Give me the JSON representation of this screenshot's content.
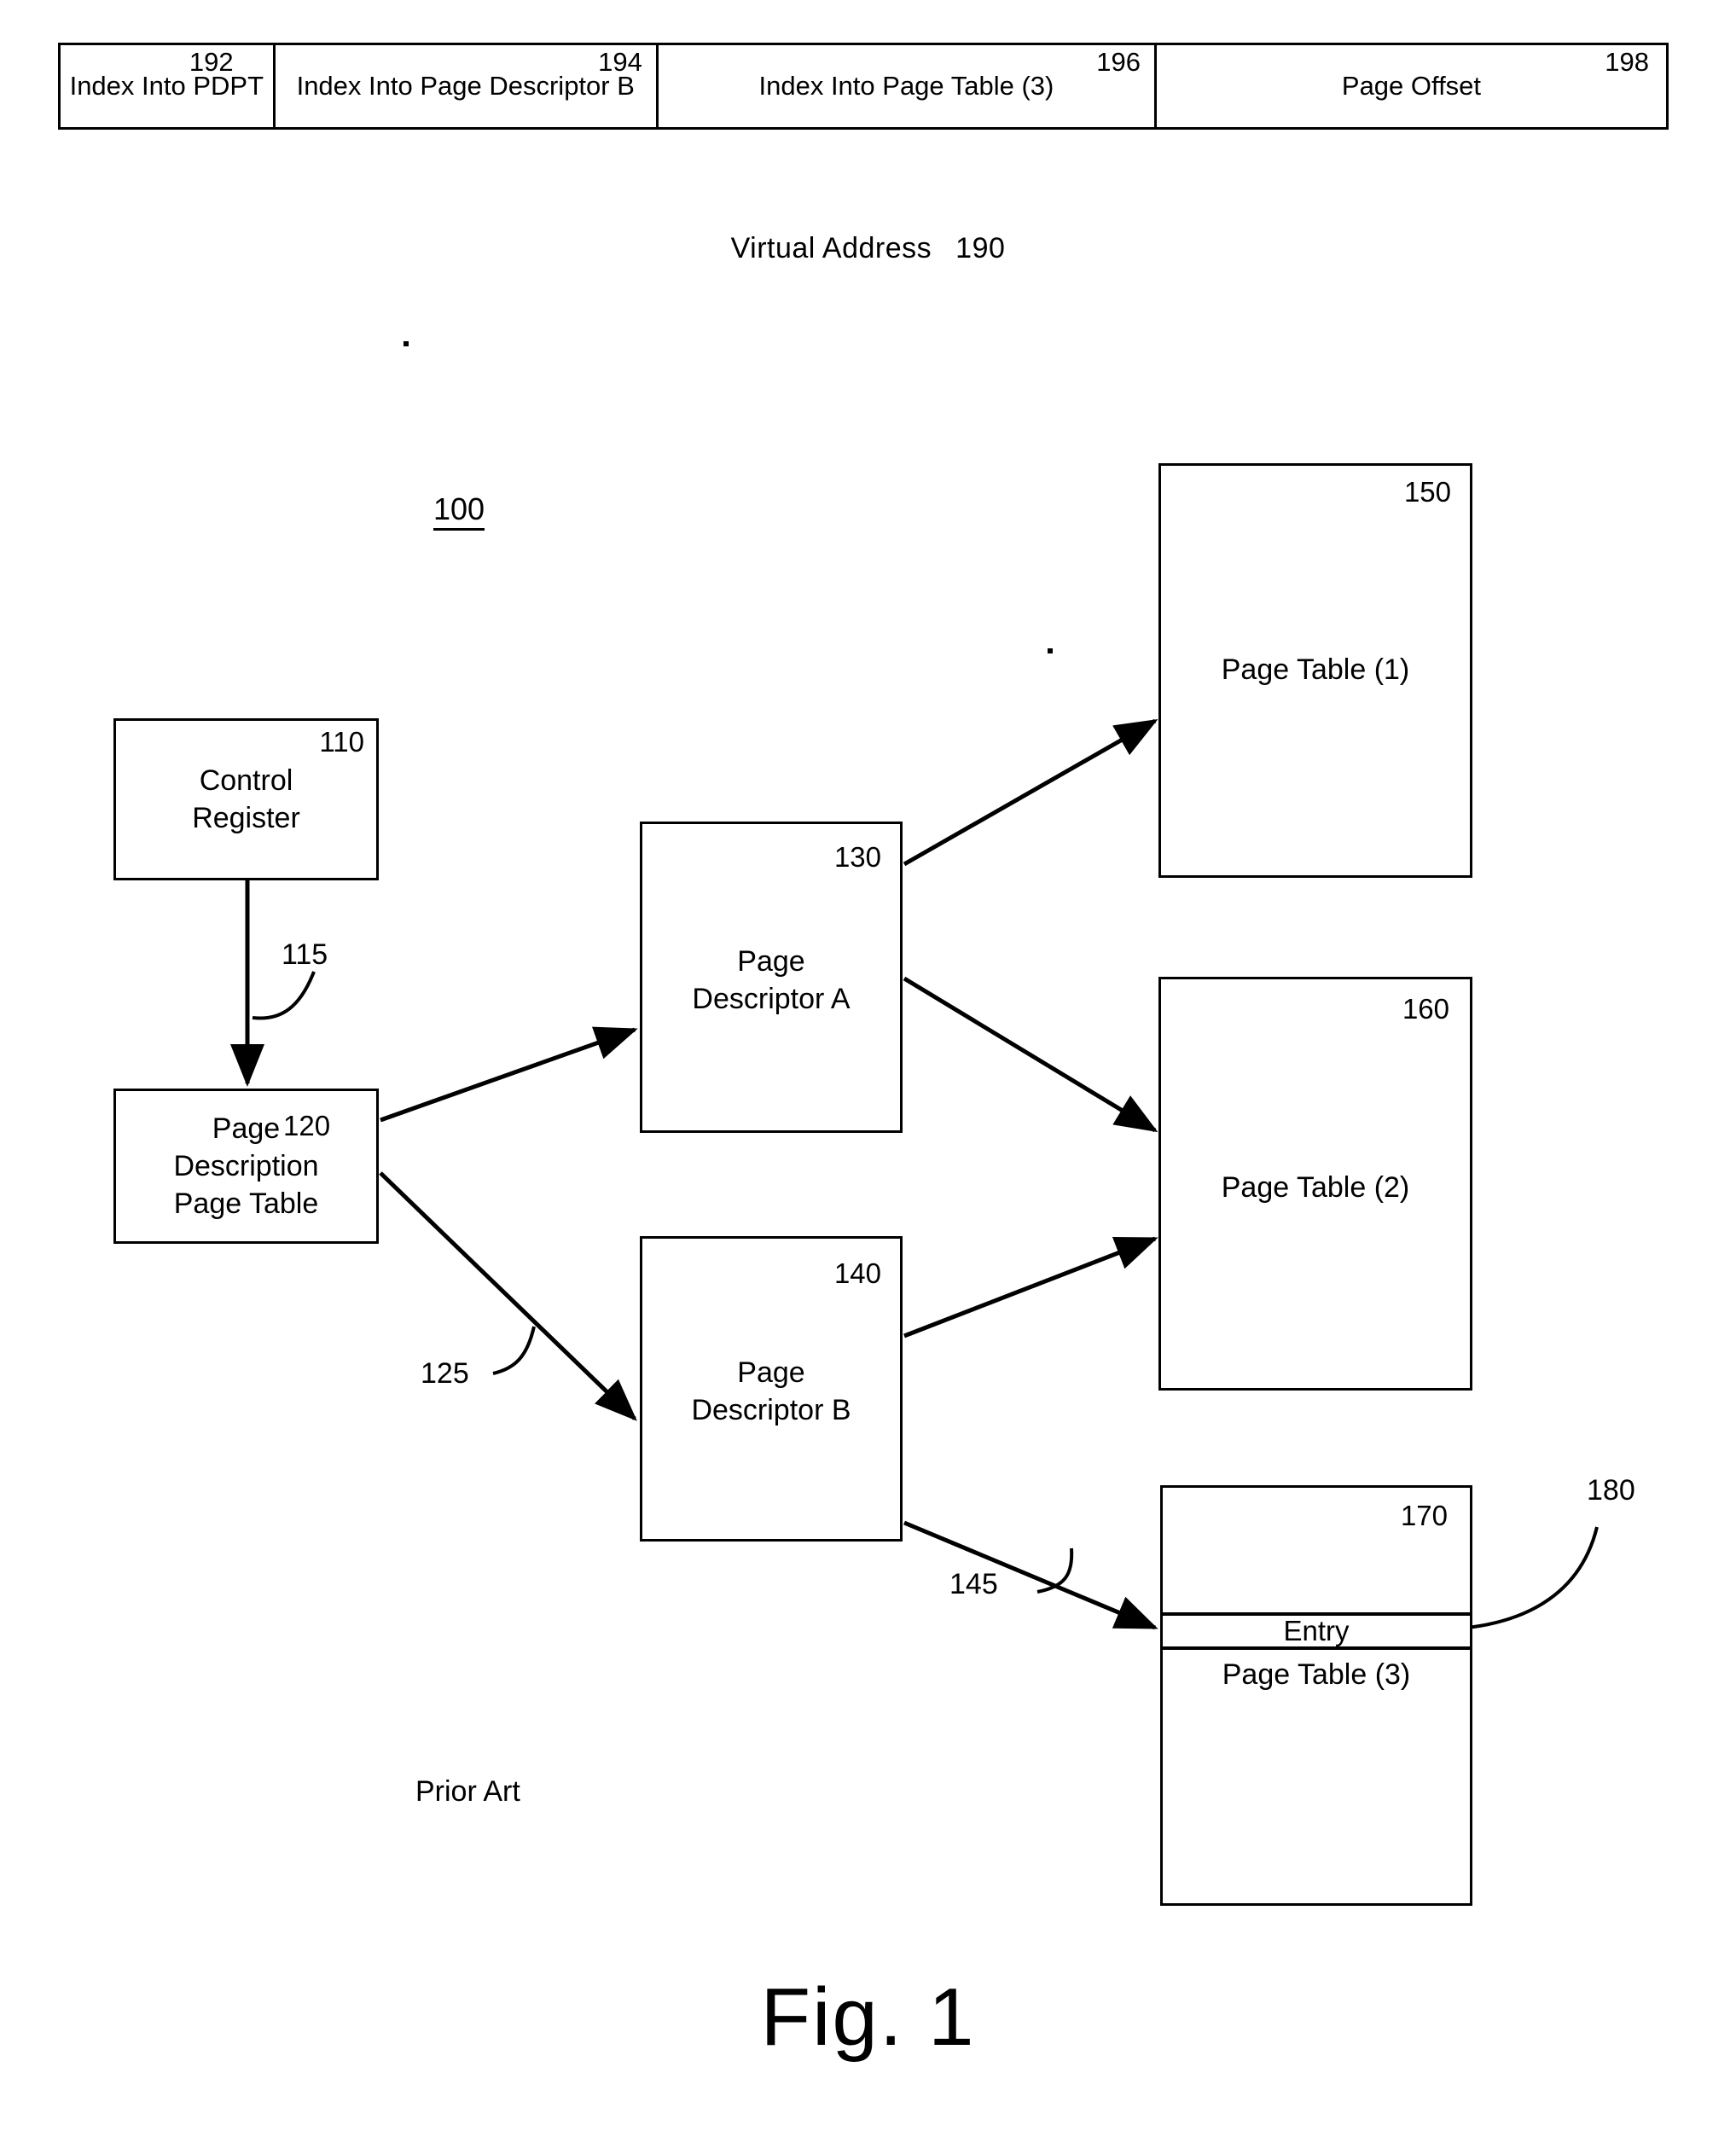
{
  "virtual_address": {
    "fields": [
      {
        "ref": "192",
        "label": "Index Into\nPDPT"
      },
      {
        "ref": "194",
        "label": "Index Into\nPage Descriptor B"
      },
      {
        "ref": "196",
        "label": "Index Into\nPage Table (3)"
      },
      {
        "ref": "198",
        "label": "Page Offset"
      }
    ],
    "caption": "Virtual Address",
    "caption_ref": "190"
  },
  "diagram": {
    "system_ref": "100",
    "boxes": {
      "control_register": {
        "ref": "110",
        "label": "Control\nRegister"
      },
      "page_description_page_table": {
        "ref": "120",
        "label": "Page\nDescription\nPage Table"
      },
      "page_descriptor_a": {
        "ref": "130",
        "label": "Page\nDescriptor A"
      },
      "page_descriptor_b": {
        "ref": "140",
        "label": "Page\nDescriptor B"
      },
      "page_table_1": {
        "ref": "150",
        "label": "Page Table (1)"
      },
      "page_table_2": {
        "ref": "160",
        "label": "Page Table (2)"
      },
      "page_table_3": {
        "ref": "170",
        "label": "Page Table (3)",
        "entry_label": "Entry",
        "entry_ref": "180"
      }
    },
    "connector_refs": {
      "control_to_pdpt": "115",
      "pdpt_to_descriptor_b": "125",
      "descriptor_b_to_page_table_3": "145"
    }
  },
  "annotations": {
    "prior_art": "Prior Art",
    "figure_caption": "Fig. 1"
  },
  "colors": {
    "ink": "#000000",
    "paper": "#ffffff"
  }
}
